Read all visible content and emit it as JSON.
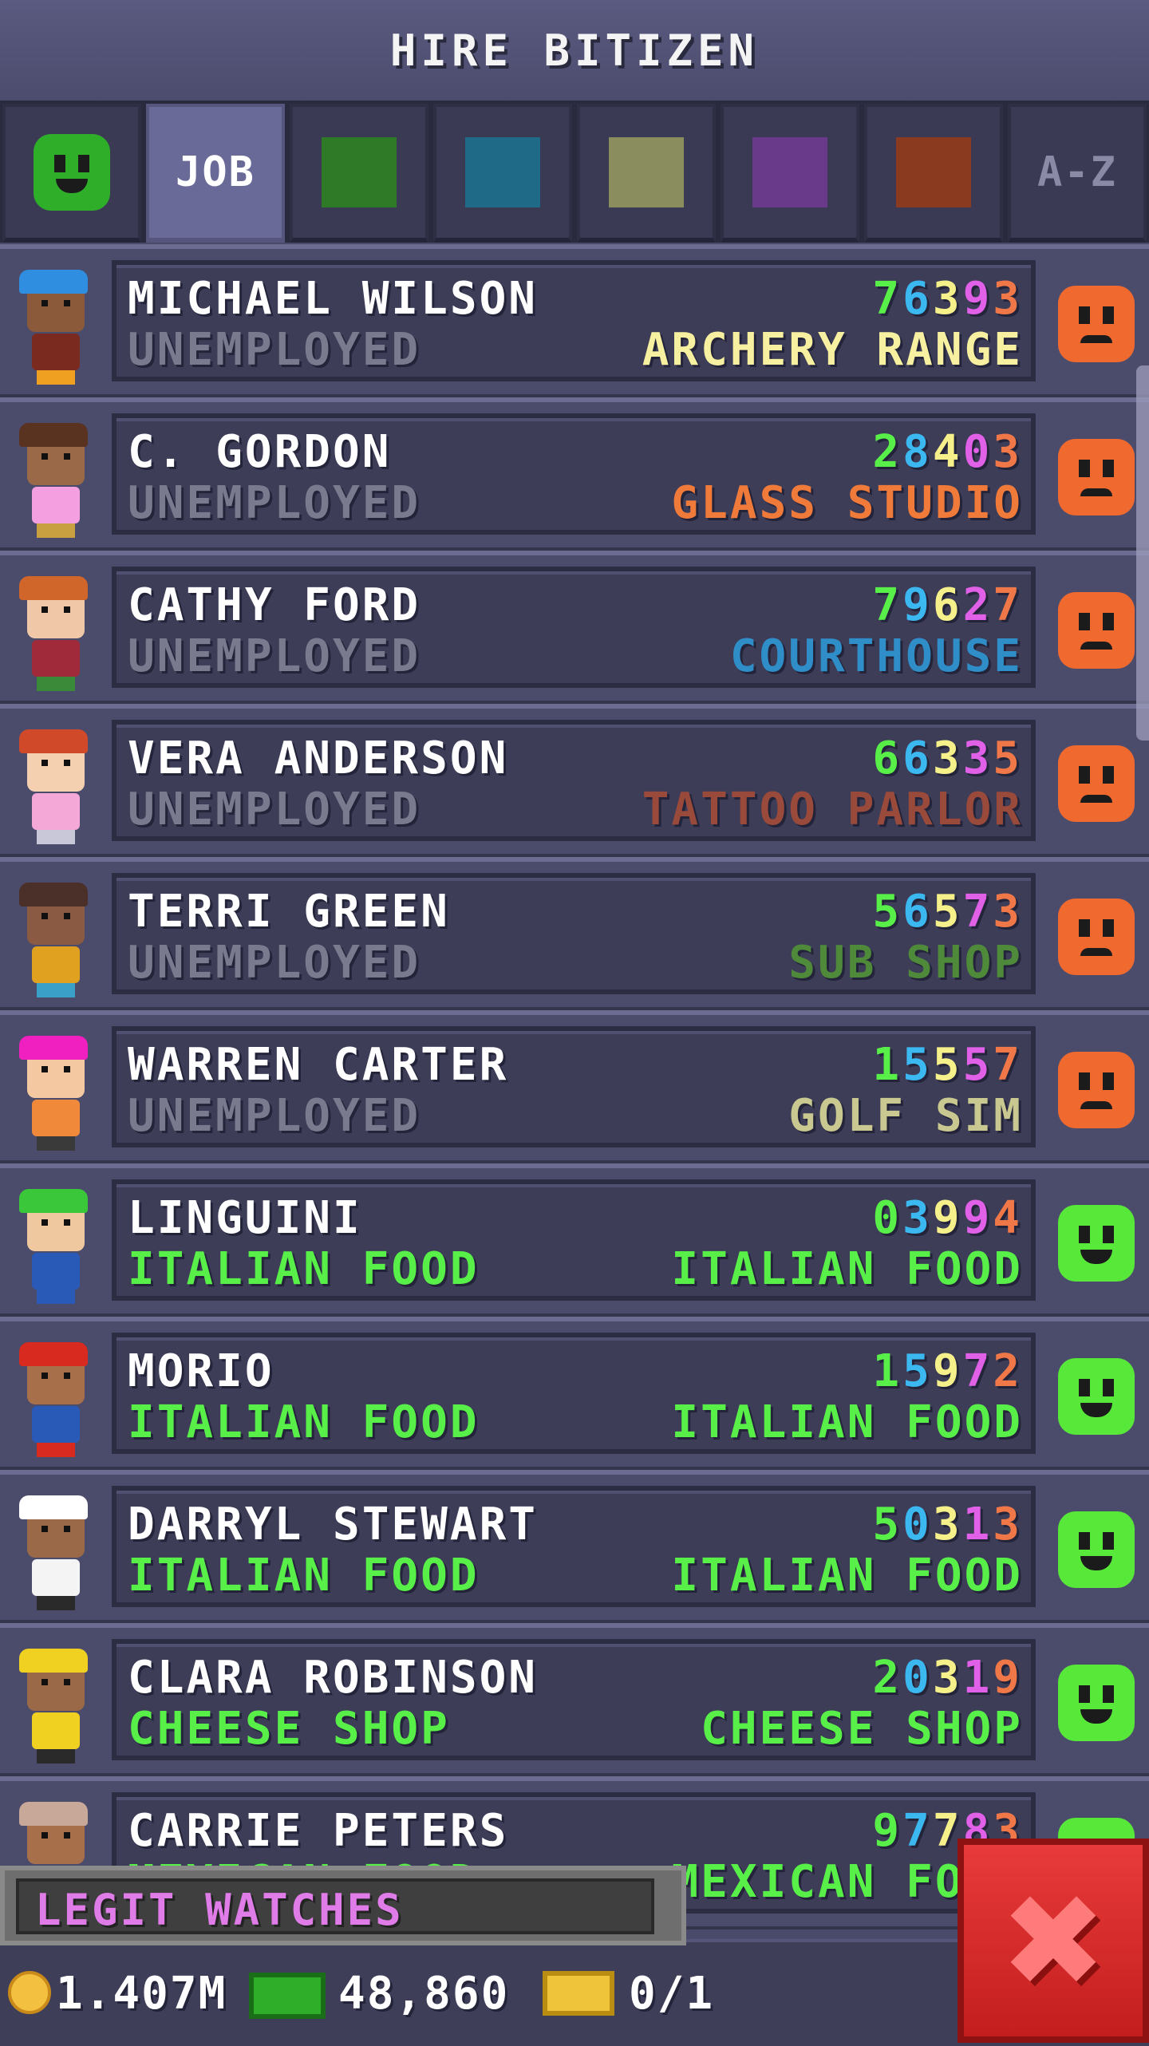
{
  "header": {
    "title": "HIRE BITIZEN"
  },
  "tabs": [
    {
      "type": "mood",
      "color": "#2fae2a"
    },
    {
      "type": "label",
      "label": "JOB",
      "active": true
    },
    {
      "type": "swatch",
      "color": "#2e7a26"
    },
    {
      "type": "swatch",
      "color": "#1f6a86"
    },
    {
      "type": "swatch",
      "color": "#8a8e5e"
    },
    {
      "type": "swatch",
      "color": "#6a3a8a"
    },
    {
      "type": "swatch",
      "color": "#8a3a1e"
    },
    {
      "type": "label",
      "label": "A-Z",
      "active": false
    }
  ],
  "digit_colors": [
    "#58f048",
    "#3cb8f0",
    "#f6f08a",
    "#e060e8",
    "#f07848"
  ],
  "rows": [
    {
      "name": "MICHAEL WILSON",
      "job": "UNEMPLOYED",
      "employed": false,
      "digits": "76393",
      "dream": "ARCHERY RANGE",
      "dream_color": "#f6f0a0",
      "mood": "sad",
      "avatar": {
        "hat": "#2f8ee0",
        "skin": "#8a5a3a",
        "body": "#7a2a1e",
        "legs": "#f0a020"
      }
    },
    {
      "name": "C. GORDON",
      "job": "UNEMPLOYED",
      "employed": false,
      "digits": "28403",
      "dream": "GLASS STUDIO",
      "dream_color": "#f07a3a",
      "mood": "sad",
      "avatar": {
        "hat": "#5a3220",
        "skin": "#9a6a48",
        "body": "#f4a0e0",
        "legs": "#c8a040"
      }
    },
    {
      "name": "CATHY FORD",
      "job": "UNEMPLOYED",
      "employed": false,
      "digits": "79627",
      "dream": "COURTHOUSE",
      "dream_color": "#2f8ec8",
      "mood": "sad",
      "avatar": {
        "hat": "#d0662a",
        "skin": "#f0c8a8",
        "body": "#a02a3a",
        "legs": "#3a8a3a"
      }
    },
    {
      "name": "VERA ANDERSON",
      "job": "UNEMPLOYED",
      "employed": false,
      "digits": "66335",
      "dream": "TATTOO PARLOR",
      "dream_color": "#9a4a3a",
      "mood": "sad",
      "avatar": {
        "hat": "#d04a2a",
        "skin": "#f4d0b0",
        "body": "#f4a8d8",
        "legs": "#c8c8d8"
      }
    },
    {
      "name": "TERRI GREEN",
      "job": "UNEMPLOYED",
      "employed": false,
      "digits": "56573",
      "dream": "SUB SHOP",
      "dream_color": "#4e8a3a",
      "mood": "sad",
      "avatar": {
        "hat": "#4a3028",
        "skin": "#8a5a42",
        "body": "#e0a020",
        "legs": "#3aa0c8"
      }
    },
    {
      "name": "WARREN CARTER",
      "job": "UNEMPLOYED",
      "employed": false,
      "digits": "15557",
      "dream": "GOLF SIM",
      "dream_color": "#c8c890",
      "mood": "sad",
      "avatar": {
        "hat": "#f020c0",
        "skin": "#f4c8a0",
        "body": "#f08a3a",
        "legs": "#3a3a3a"
      }
    },
    {
      "name": "LINGUINI",
      "job": "ITALIAN FOOD",
      "employed": true,
      "digits": "03994",
      "dream": "ITALIAN FOOD",
      "dream_color": "#58f048",
      "mood": "happy",
      "avatar": {
        "hat": "#3ac83a",
        "skin": "#f0c8a0",
        "body": "#2a5ab8",
        "legs": "#2a5ab8"
      }
    },
    {
      "name": "MORIO",
      "job": "ITALIAN FOOD",
      "employed": true,
      "digits": "15972",
      "dream": "ITALIAN FOOD",
      "dream_color": "#58f048",
      "mood": "happy",
      "avatar": {
        "hat": "#d82a1e",
        "skin": "#a8704a",
        "body": "#2a5ab8",
        "legs": "#d82a1e"
      }
    },
    {
      "name": "DARRYL STEWART",
      "job": "ITALIAN FOOD",
      "employed": true,
      "digits": "50313",
      "dream": "ITALIAN FOOD",
      "dream_color": "#58f048",
      "mood": "happy",
      "avatar": {
        "hat": "#ffffff",
        "skin": "#9a6a48",
        "body": "#f4f4f4",
        "legs": "#2a2a2a"
      }
    },
    {
      "name": "CLARA ROBINSON",
      "job": "CHEESE SHOP",
      "employed": true,
      "digits": "20319",
      "dream": "CHEESE SHOP",
      "dream_color": "#58f048",
      "mood": "happy",
      "avatar": {
        "hat": "#f0d020",
        "skin": "#9a6a48",
        "body": "#f0d020",
        "legs": "#2a2a2a"
      }
    },
    {
      "name": "CARRIE PETERS",
      "job": "MEXICAN FOOD",
      "employed": true,
      "digits": "97783",
      "dream": "MEXICAN FOOD",
      "dream_color": "#58f048",
      "mood": "happy",
      "avatar": {
        "hat": "#c8a898",
        "skin": "#a8704a",
        "body": "#2a2a2a",
        "legs": "#2a2a2a"
      }
    }
  ],
  "ad": {
    "text": "LEGIT WATCHES"
  },
  "footer": {
    "coins": "1.407M",
    "bux": "48,860",
    "tickets": "0/1"
  },
  "colors": {
    "sad_face": "#f06a30",
    "happy_face": "#58e83a",
    "mood_tab_face": "#2fae2a"
  }
}
